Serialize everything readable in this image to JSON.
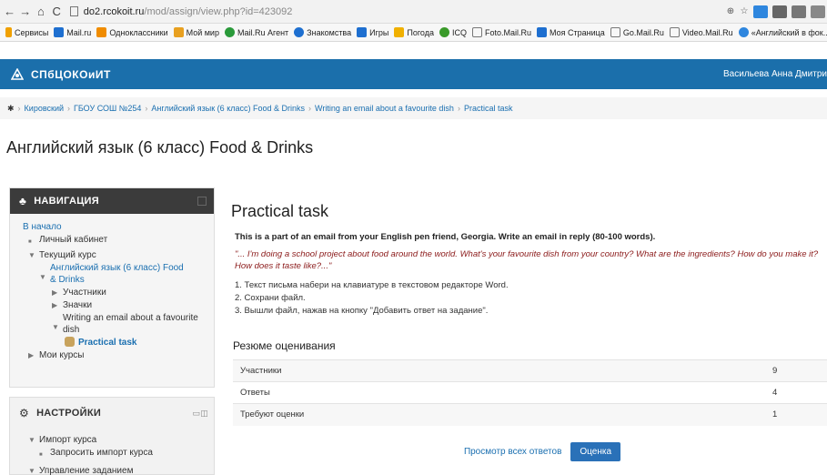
{
  "browser": {
    "url_domain": "do2.rcokoit.ru",
    "url_path": "/mod/assign/view.php?id=423092",
    "bookmarks": [
      "Сервисы",
      "Mail.ru",
      "Одноклассники",
      "Мой мир",
      "Mail.Ru Агент",
      "Знакомства",
      "Игры",
      "Погода",
      "ICQ",
      "Foto.Mail.Ru",
      "Моя Страница",
      "Go.Mail.Ru",
      "Video.Mail.Ru",
      "«Английский в фок..."
    ]
  },
  "header": {
    "site_name": "СПбЦОКОиИТ",
    "user": "Васильева Анна Дмитри"
  },
  "breadcrumb": [
    "Кировский",
    "ГБОУ СОШ №254",
    "Английский язык (6 класс) Food & Drinks",
    "Writing an email about a favourite dish",
    "Practical task"
  ],
  "course_title": "Английский язык (6 класс) Food & Drinks",
  "navigation": {
    "title": "НАВИГАЦИЯ",
    "home": "В начало",
    "dashboard": "Личный кабинет",
    "current_course": "Текущий курс",
    "course": "Английский язык (6 класс) Food & Drinks",
    "participants": "Участники",
    "badges": "Значки",
    "topic": "Writing an email about a favourite dish",
    "current": "Practical task",
    "my_courses": "Мои курсы"
  },
  "settings": {
    "title": "НАСТРОЙКИ",
    "import": "Импорт курса",
    "request_import": "Запросить импорт курса",
    "manage": "Управление заданием"
  },
  "task": {
    "title": "Practical task",
    "intro": "This is a part of an email from your English pen friend, Georgia. Write an email in reply (80-100 words).",
    "quote": "\"... I'm doing a school project about food around the world. What's your favourite dish from your country? What are the ingredients? How do you make it? How does it taste like?...\"",
    "steps": [
      "1.  Текст письма набери на клавиатуре в текстовом редакторе Word.",
      "2.  Сохрани файл.",
      "3.  Вышли файл, нажав на кнопку \"Добавить ответ на задание\"."
    ]
  },
  "grading": {
    "title": "Резюме оценивания",
    "rows": [
      {
        "label": "Участники",
        "value": "9"
      },
      {
        "label": "Ответы",
        "value": "4"
      },
      {
        "label": "Требуют оценки",
        "value": "1"
      }
    ],
    "view_all": "Просмотр всех ответов",
    "grade": "Оценка"
  }
}
